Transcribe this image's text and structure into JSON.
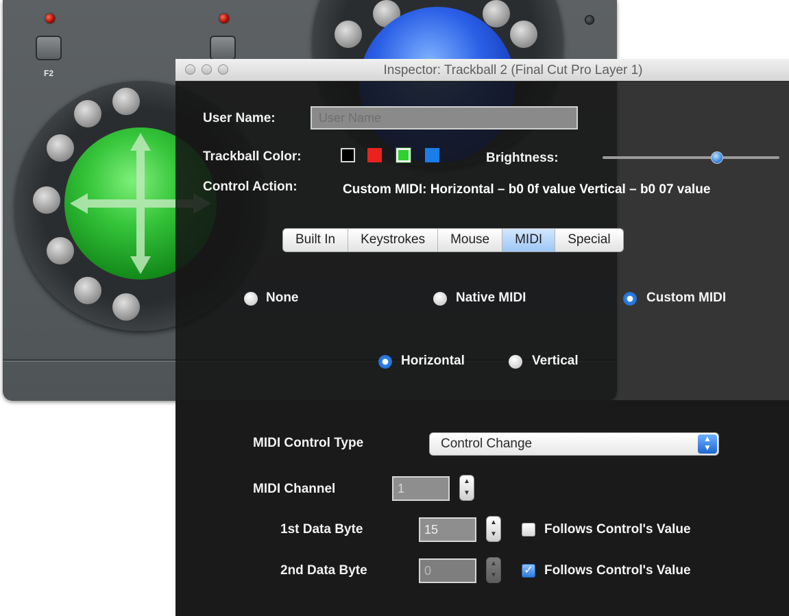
{
  "hardware": {
    "button_label": "F2"
  },
  "window": {
    "title": "Inspector: Trackball 2 (Final Cut Pro Layer 1)"
  },
  "form": {
    "user_name_label": "User Name:",
    "user_name_placeholder": "User Name",
    "trackball_color_label": "Trackball Color:",
    "swatches": [
      {
        "name": "black",
        "color": "#000000"
      },
      {
        "name": "red",
        "color": "#e8231d"
      },
      {
        "name": "green",
        "color": "#2fd12f"
      },
      {
        "name": "blue",
        "color": "#1a7ee8"
      }
    ],
    "selected_swatch": "green",
    "brightness_label": "Brightness:",
    "brightness_value": 0.65,
    "control_action_label": "Control Action:",
    "control_action_value": "Custom MIDI: Horizontal – b0 0f value Vertical – b0 07 value"
  },
  "tabs": [
    "Built In",
    "Keystrokes",
    "Mouse",
    "MIDI",
    "Special"
  ],
  "active_tab": "MIDI",
  "midi_mode": {
    "options": [
      "None",
      "Native MIDI",
      "Custom MIDI"
    ],
    "selected": "Custom MIDI"
  },
  "axis": {
    "options": [
      "Horizontal",
      "Vertical"
    ],
    "selected": "Horizontal"
  },
  "midi": {
    "control_type_label": "MIDI Control Type",
    "control_type_value": "Control Change",
    "channel_label": "MIDI Channel",
    "channel_value": "1",
    "data_byte1_label": "1st Data Byte",
    "data_byte1_value": "15",
    "data_byte1_follows_label": "Follows Control's Value",
    "data_byte1_follows": false,
    "data_byte2_label": "2nd Data Byte",
    "data_byte2_value": "0",
    "data_byte2_follows_label": "Follows Control's Value",
    "data_byte2_follows": true
  }
}
